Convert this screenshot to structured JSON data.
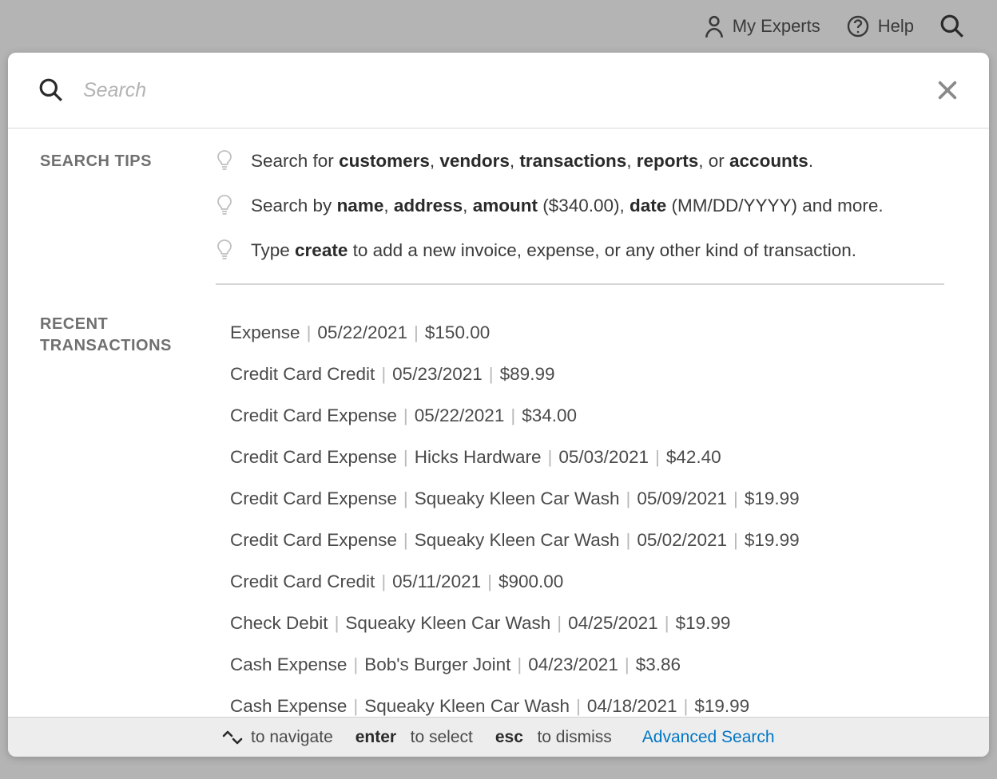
{
  "topbar": {
    "experts_label": "My Experts",
    "help_label": "Help"
  },
  "search": {
    "placeholder": "Search"
  },
  "sections": {
    "tips_label": "SEARCH TIPS",
    "recent_label": "RECENT TRANSACTIONS"
  },
  "tips": [
    {
      "html": "Search for <b>customers</b>, <b>vendors</b>, <b>transactions</b>, <b>reports</b>, or <b>accounts</b>."
    },
    {
      "html": "Search by <b>name</b>, <b>address</b>, <b>amount</b> ($340.00), <b>date</b> (MM/DD/YYYY) and more."
    },
    {
      "html": "Type <b>create</b> to add a new invoice, expense, or any other kind of transaction."
    }
  ],
  "transactions": [
    {
      "type": "Expense",
      "payee": "",
      "date": "05/22/2021",
      "amount": "$150.00"
    },
    {
      "type": "Credit Card Credit",
      "payee": "",
      "date": "05/23/2021",
      "amount": "$89.99"
    },
    {
      "type": "Credit Card Expense",
      "payee": "",
      "date": "05/22/2021",
      "amount": "$34.00"
    },
    {
      "type": "Credit Card Expense",
      "payee": "Hicks Hardware",
      "date": "05/03/2021",
      "amount": "$42.40"
    },
    {
      "type": "Credit Card Expense",
      "payee": "Squeaky Kleen Car Wash",
      "date": "05/09/2021",
      "amount": "$19.99"
    },
    {
      "type": "Credit Card Expense",
      "payee": "Squeaky Kleen Car Wash",
      "date": "05/02/2021",
      "amount": "$19.99"
    },
    {
      "type": "Credit Card Credit",
      "payee": "",
      "date": "05/11/2021",
      "amount": "$900.00"
    },
    {
      "type": "Check Debit",
      "payee": "Squeaky Kleen Car Wash",
      "date": "04/25/2021",
      "amount": "$19.99"
    },
    {
      "type": "Cash Expense",
      "payee": "Bob's Burger Joint",
      "date": "04/23/2021",
      "amount": "$3.86"
    },
    {
      "type": "Cash Expense",
      "payee": "Squeaky Kleen Car Wash",
      "date": "04/18/2021",
      "amount": "$19.99"
    }
  ],
  "footer": {
    "navigate": "to navigate",
    "enter_key": "enter",
    "select": "to select",
    "esc_key": "esc",
    "dismiss": "to dismiss",
    "advanced": "Advanced Search"
  }
}
